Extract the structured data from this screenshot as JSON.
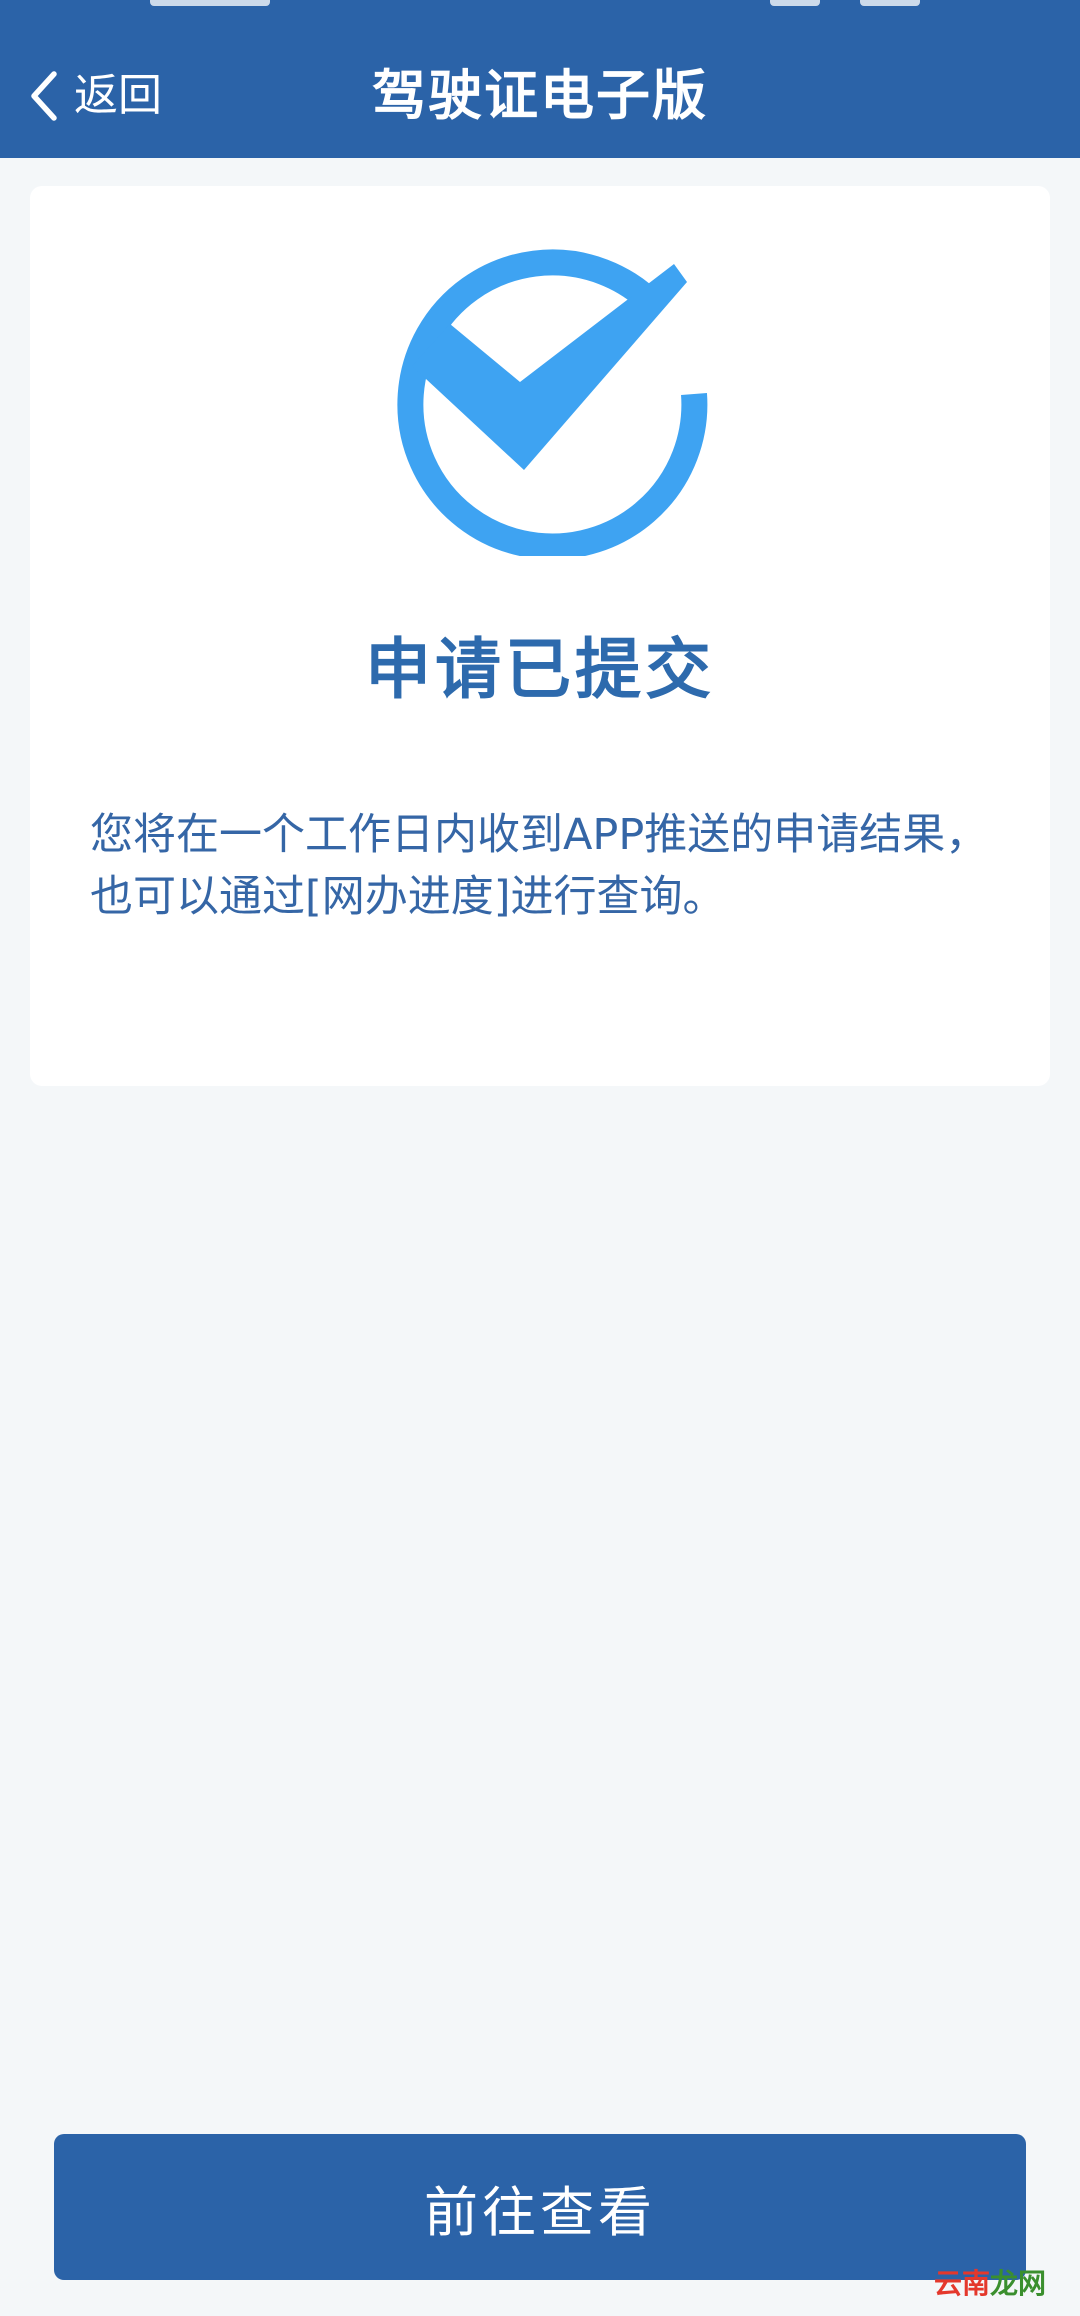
{
  "header": {
    "back_label": "返回",
    "title": "驾驶证电子版"
  },
  "result": {
    "icon": "check-circle-icon",
    "title": "申请已提交",
    "message": "您将在一个工作日内收到APP推送的申请结果，也可以通过[网办进度]进行查询。"
  },
  "actions": {
    "primary_label": "前往查看"
  },
  "watermark": {
    "part_red": "云南",
    "part_green": "龙网"
  },
  "colors": {
    "header_bg": "#2b63a8",
    "page_bg": "#f4f7f9",
    "accent": "#3ea3f2",
    "title_text": "#2d6aad",
    "body_text": "#3566a6",
    "button_bg": "#2b63a8"
  }
}
